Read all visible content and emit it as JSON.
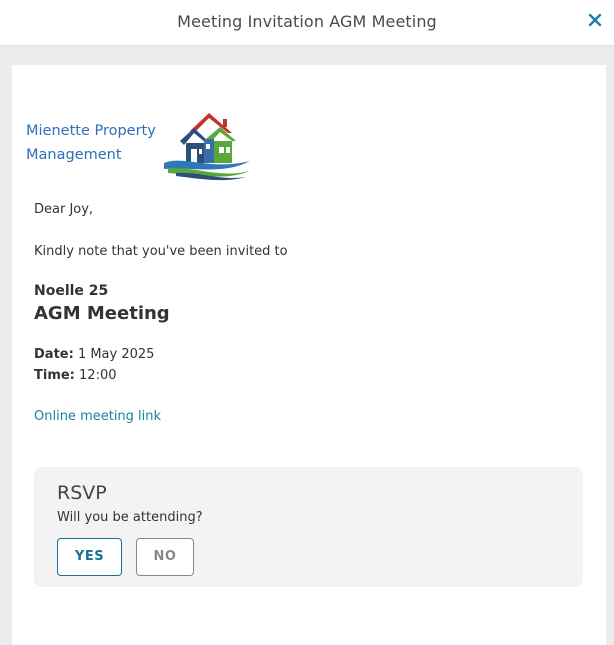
{
  "header": {
    "title": "Meeting Invitation AGM Meeting",
    "close_icon": "close-icon",
    "accent_color": "#1a7fa6"
  },
  "logo": {
    "line1": "Mienette Property",
    "line2": "Management",
    "icon": "houses-logo-icon",
    "text_color": "#2e6fb5"
  },
  "message": {
    "greeting": "Dear Joy,",
    "intro": "Kindly note that you've been invited to"
  },
  "meeting": {
    "subtitle": "Noelle 25",
    "title": "AGM Meeting",
    "date_label": "Date:",
    "date_value": "1 May 2025",
    "time_label": "Time:",
    "time_value": "12:00",
    "link_text": "Online meeting link"
  },
  "rsvp": {
    "heading": "RSVP",
    "question": "Will you be attending?",
    "yes_label": "YES",
    "no_label": "NO"
  }
}
